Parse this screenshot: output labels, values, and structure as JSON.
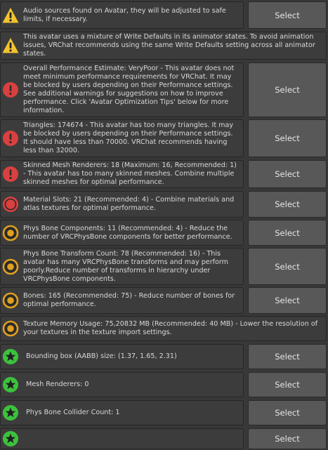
{
  "select_label": "Select",
  "colors": {
    "warning": "#f2c230",
    "error": "#d94040",
    "info": "#e0a020",
    "ok": "#3cc23c"
  },
  "items": [
    {
      "type": "warning-icon",
      "text": "Audio sources found on Avatar, they will be adjusted to safe limits, if necessary.",
      "has_button": true
    },
    {
      "type": "warning-icon",
      "text": "This avatar uses a mixture of Write Defaults in its animator states. To avoid animation issues, VRChat recommends using the same Write Defaults setting across all animator states.",
      "has_button": false
    },
    {
      "type": "error-icon",
      "text": "Overall Performance Estimate: VeryPoor - This avatar does not meet minimum performance requirements for VRChat. It may be blocked by users depending on their Performance settings. See additional warnings for suggestions on how to improve performance. Click 'Avatar Optimization Tips' below for more information.",
      "has_button": true
    },
    {
      "type": "error-icon",
      "text": "Triangles: 174674 - This avatar has too many triangles. It may be blocked by users depending on their Performance settings. It should have less than 70000. VRChat recommends having less than 32000.",
      "has_button": true
    },
    {
      "type": "error-icon",
      "text": "Skinned Mesh Renderers: 18 (Maximum: 16, Recommended: 1) - This avatar has too many skinned meshes. Combine multiple skinned meshes for optimal performance.",
      "has_button": true
    },
    {
      "type": "poor-icon",
      "text": "Material Slots: 21 (Recommended: 4) - Combine materials and atlas textures for optimal performance.",
      "has_button": true
    },
    {
      "type": "medium-icon",
      "text": "Phys Bone Components: 11 (Recommended: 4) - Reduce the number of VRCPhysBone components for better performance.",
      "has_button": true
    },
    {
      "type": "medium-icon",
      "text": "Phys Bone Transform Count: 78 (Recommended: 16) - This avatar has many VRCPhysBone transforms and may perform poorly.Reduce number of transforms in hierarchy under VRCPhysBone components.",
      "has_button": true
    },
    {
      "type": "medium-icon",
      "text": "Bones: 165 (Recommended: 75) - Reduce number of bones for optimal performance.",
      "has_button": true
    },
    {
      "type": "medium-icon",
      "text": "Texture Memory Usage: 75,20832 MB (Recommended: 40 MB) - Lower the resolution of your textures in the texture import settings.",
      "has_button": false
    },
    {
      "type": "star-icon",
      "text": "Bounding box (AABB) size: (1.37, 1.65, 2.31)",
      "has_button": true
    },
    {
      "type": "star-icon",
      "text": "Mesh Renderers: 0",
      "has_button": true
    },
    {
      "type": "star-icon",
      "text": "Phys Bone Collider Count: 1",
      "has_button": true
    },
    {
      "type": "star-icon",
      "text": "",
      "has_button": true
    }
  ]
}
